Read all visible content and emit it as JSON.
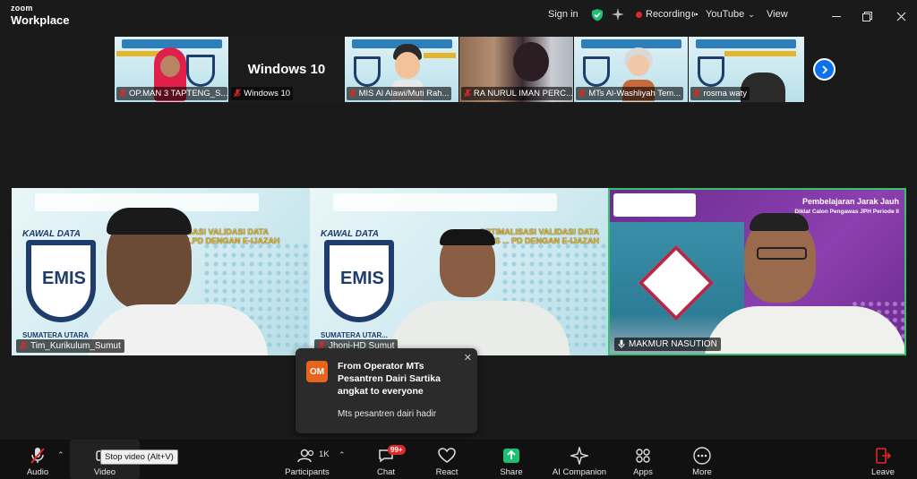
{
  "app": {
    "brand_small": "zoom",
    "brand_large": "Workplace"
  },
  "titlebar": {
    "sign_in": "Sign in",
    "recording": "Recording",
    "youtube": "YouTube",
    "view": "View"
  },
  "gallery": {
    "tiles": [
      {
        "name": "OP.MAN 3 TAPTENG_S..."
      },
      {
        "name": "Windows 10",
        "big_text": "Windows 10"
      },
      {
        "name": "MIS Al Alawi/Muti Rah..."
      },
      {
        "name": "RA NURUL IMAN PERC..."
      },
      {
        "name": "MTs Al-Washliyah Tem..."
      },
      {
        "name": "rosma waty"
      }
    ]
  },
  "main": {
    "videos": [
      {
        "name": "Tim_Kurikulum_Sumut",
        "slide_title": "KAWAL DATA",
        "slide_sub": "SASI VALIDASI DATA\nLPD DENGAN E-IJAZAH",
        "logo_text": "EMIS",
        "footer_text": "SUMATERA UTARA"
      },
      {
        "name": "Jhoni-HD Sumut",
        "slide_title": "KAWAL DATA",
        "slide_sub": "OPTIMALISASI VALIDASI DATA\nEMIS ... PD DENGAN E-IJAZAH",
        "logo_text": "EMIS",
        "footer_text": "SUMATERA UTAR..."
      },
      {
        "name": "MAKMUR NASUTION",
        "banner_title": "Pembelajaran Jarak Jauh",
        "banner_sub": "Diklat Calon Pengawas JPH Periode II"
      }
    ]
  },
  "toast": {
    "avatar": "OM",
    "title": "From Operator MTs Pesantren Dairi Sartika angkat to everyone",
    "message": "Mts pesantren dairi hadir"
  },
  "toolbar": {
    "audio": "Audio",
    "video": "Video",
    "video_tooltip": "Stop video (Alt+V)",
    "participants": "Participants",
    "participant_count": "1K",
    "chat": "Chat",
    "chat_badge": "99+",
    "react": "React",
    "share": "Share",
    "ai_companion": "AI Companion",
    "apps": "Apps",
    "more": "More",
    "leave": "Leave"
  },
  "colors": {
    "accent_blue": "#0e71eb",
    "share_green": "#1dbf73",
    "active_speaker": "#35c26a",
    "recording_red": "#e02828",
    "leave_red": "#e02828"
  }
}
